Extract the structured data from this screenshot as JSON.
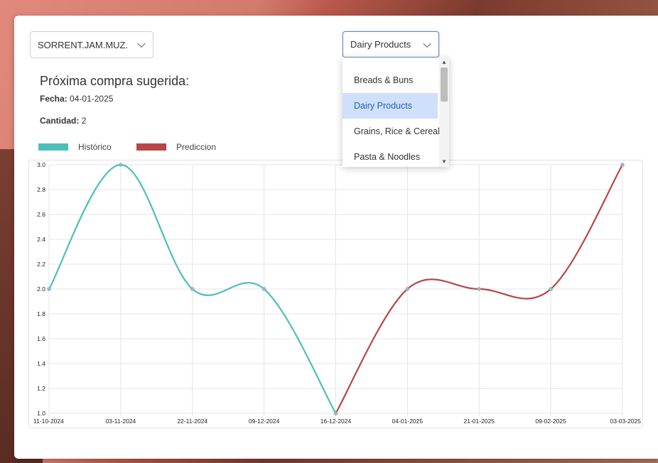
{
  "filters": {
    "store_select_value": "SORRENT.JAM.MUZ.",
    "category_select_value": "Dairy Products",
    "category_options": [
      "Breads & Buns",
      "Dairy Products",
      "Grains, Rice & Cereal",
      "Pasta & Noodles"
    ],
    "category_selected_index": 1
  },
  "summary": {
    "heading": "Próxima compra sugerida:",
    "fecha_label": "Fecha:",
    "fecha_value": "04-01-2025",
    "cantidad_label": "Cantidad:",
    "cantidad_value": "2"
  },
  "colors": {
    "historico": "#4dbfb9",
    "prediccion": "#b94545"
  },
  "chart_data": {
    "type": "line",
    "categories": [
      "11-10-2024",
      "03-11-2024",
      "22-11-2024",
      "09-12-2024",
      "16-12-2024",
      "04-01-2025",
      "21-01-2025",
      "09-02-2025",
      "03-03-2025"
    ],
    "series": [
      {
        "name": "Histórico",
        "values": [
          2.0,
          3.0,
          2.0,
          2.0,
          1.0,
          null,
          null,
          null,
          null
        ]
      },
      {
        "name": "Prediccion",
        "values": [
          null,
          null,
          null,
          null,
          1.0,
          2.0,
          2.0,
          2.0,
          3.0
        ]
      }
    ],
    "ylim": [
      1.0,
      3.0
    ],
    "yticks": [
      "1.0",
      "1.2",
      "1.4",
      "1.6",
      "1.8",
      "2.0",
      "2.2",
      "2.4",
      "2.6",
      "2.8",
      "3.0"
    ],
    "grid": true,
    "legend": "top-left"
  }
}
